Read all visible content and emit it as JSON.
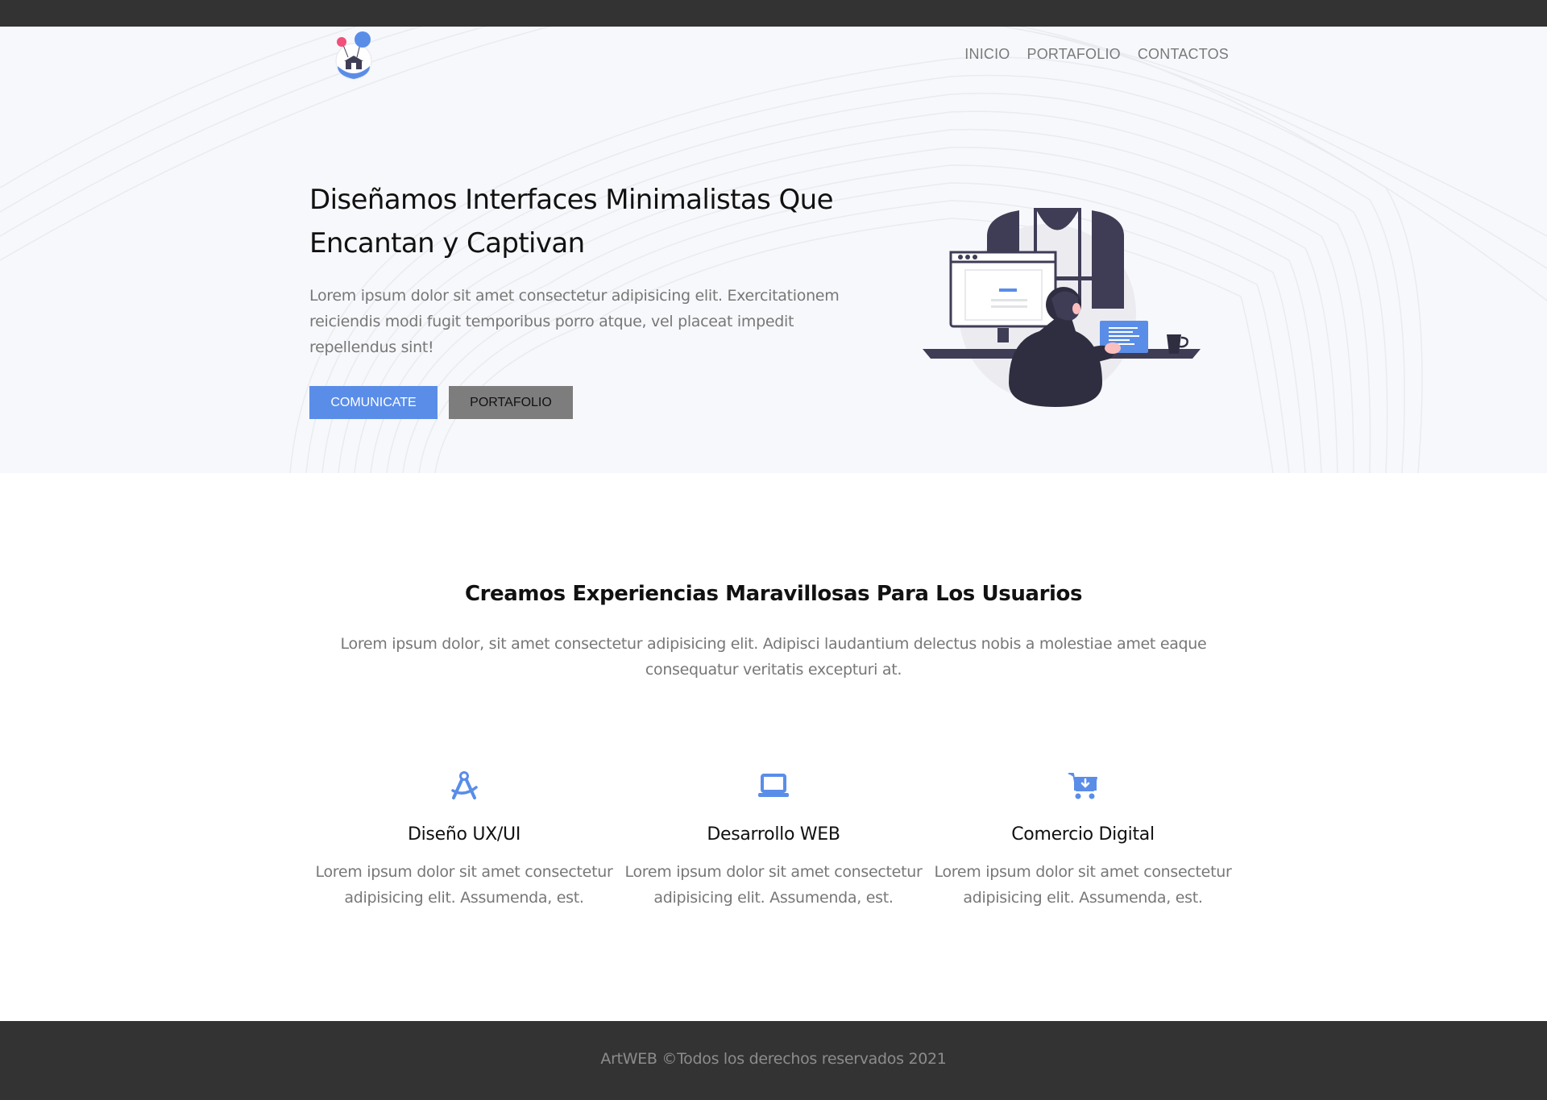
{
  "nav": {
    "items": [
      {
        "label": "INICIO"
      },
      {
        "label": "PORTAFOLIO"
      },
      {
        "label": "CONTACTOS"
      }
    ]
  },
  "hero": {
    "title": "Diseñamos Interfaces Minimalistas Que Encantan y Captivan",
    "text": "Lorem ipsum dolor sit amet consectetur adipisicing elit. Exercitationem reiciendis modi fugit temporibus porro atque, vel placeat impedit repellendus sint!",
    "primary_button": "COMUNICATE",
    "secondary_button": "PORTAFOLIO"
  },
  "section": {
    "title": "Creamos Experiencias Maravillosas Para Los Usuarios",
    "text": "Lorem ipsum dolor, sit amet consectetur adipisicing elit. Adipisci laudantium delectus nobis a molestiae amet eaque consequatur veritatis excepturi at."
  },
  "features": [
    {
      "icon": "compass-drafting-icon",
      "title": "Diseño UX/UI",
      "text": "Lorem ipsum dolor sit amet consectetur adipisicing elit. Assumenda, est."
    },
    {
      "icon": "laptop-icon",
      "title": "Desarrollo WEB",
      "text": "Lorem ipsum dolor sit amet consectetur adipisicing elit. Assumenda, est."
    },
    {
      "icon": "cart-download-icon",
      "title": "Comercio Digital",
      "text": "Lorem ipsum dolor sit amet consectetur adipisicing elit. Assumenda, est."
    }
  ],
  "footer": {
    "text": "ArtWEB ©Todos los derechos reservados 2021"
  },
  "colors": {
    "accent": "#5a8de8",
    "dark_bar": "#333333",
    "hero_bg": "#f7f8fb",
    "muted_text": "#777777"
  }
}
